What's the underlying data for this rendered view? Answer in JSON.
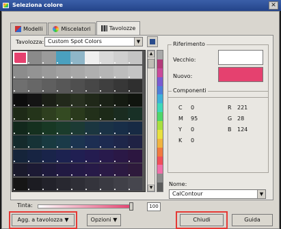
{
  "window": {
    "title": "Seleziona colore",
    "close_glyph": "✕"
  },
  "tabs": [
    {
      "label": "Modelli",
      "icon": "models-icon"
    },
    {
      "label": "Miscelatori",
      "icon": "mixers-icon"
    },
    {
      "label": "Tavolozze",
      "icon": "palettes-icon"
    }
  ],
  "palette_panel": {
    "label": "Tavolozza:",
    "selected": "Custom Spot Colors",
    "swatches": [
      [
        "#e5416f",
        "#8a8a8a",
        "#9b9b9b",
        "#4aa0bf",
        "#8fb6c8",
        "#efefef",
        "#d9d9d9",
        "#cfcfcf",
        "#c4c4c4"
      ],
      [
        "#8c8c8c",
        "#939393",
        "#9a9a9a",
        "#a1a1a1",
        "#a8a8a8",
        "#afafaf",
        "#b6b6b6",
        "#bdbdbd",
        "#c4c4c4"
      ],
      [
        "#6f6f6f",
        "#676767",
        "#5f5f5f",
        "#575757",
        "#4f4f4f",
        "#474747",
        "#3f3f3f",
        "#373737",
        "#2f2f2f"
      ],
      [
        "#0d0d0d",
        "#141414",
        "#1b1f16",
        "#22291b",
        "#283020",
        "#202819",
        "#1a2116",
        "#151b12",
        "#10140e"
      ],
      [
        "#1e2a17",
        "#24341a",
        "#2e3f1f",
        "#344a22",
        "#2a3a1c",
        "#22301a",
        "#1c2a18",
        "#1a2c20",
        "#183026"
      ],
      [
        "#12281c",
        "#15301f",
        "#183824",
        "#1b3c2c",
        "#1c3a34",
        "#1b3640",
        "#1a3246",
        "#182e48",
        "#172a44"
      ],
      [
        "#142a2c",
        "#163236",
        "#183a40",
        "#1a3a48",
        "#1b3450",
        "#1c2e52",
        "#1d2a50",
        "#1e264a",
        "#1f2244"
      ],
      [
        "#15243a",
        "#172442",
        "#19244a",
        "#1c2250",
        "#201f52",
        "#241c50",
        "#281a4c",
        "#2a1846",
        "#2c1640"
      ],
      [
        "#1a1a2c",
        "#1c1a34",
        "#1e1a3c",
        "#211a42",
        "#241a46",
        "#271a48",
        "#2a1a46",
        "#2c1a42",
        "#2e1a3c"
      ],
      [
        "#161616",
        "#1c1c22",
        "#22222a",
        "#282830",
        "#2e2e36",
        "#34343c",
        "#3a3a42",
        "#404048",
        "#46464e"
      ]
    ],
    "spectrum": [
      "#a9a9a9",
      "#b33b7a",
      "#c94a9a",
      "#7a5bd0",
      "#4e7ed8",
      "#3fb1d8",
      "#3fd8b8",
      "#4fd66a",
      "#a8df3f",
      "#e8e03f",
      "#f0b43f",
      "#f07a3f",
      "#f04f5a",
      "#f06fa8",
      "#8a8a8a",
      "#5c5c5c"
    ]
  },
  "references": {
    "title": "Riferimento",
    "old_label": "Vecchio:",
    "old_color": "#ffffff",
    "new_label": "Nuovo:",
    "new_color": "#e5416f"
  },
  "components": {
    "title": "Componenti",
    "cmyk": [
      {
        "label": "C",
        "value": "0"
      },
      {
        "label": "M",
        "value": "95"
      },
      {
        "label": "Y",
        "value": "0"
      },
      {
        "label": "K",
        "value": "0"
      }
    ],
    "rgb": [
      {
        "label": "R",
        "value": "221"
      },
      {
        "label": "G",
        "value": "28"
      },
      {
        "label": "B",
        "value": "124"
      }
    ]
  },
  "name_field": {
    "label": "Nome:",
    "value": "CalContour"
  },
  "tint": {
    "label": "Tinta:",
    "value": "100",
    "level": 1.0
  },
  "buttons": {
    "add_to_palette": "Agg. a tavolozza",
    "options": "Opzioni",
    "close": "Chiudi",
    "help": "Guida"
  },
  "glyphs": {
    "down": "▼",
    "up": "▲"
  },
  "accent": "#e53935"
}
